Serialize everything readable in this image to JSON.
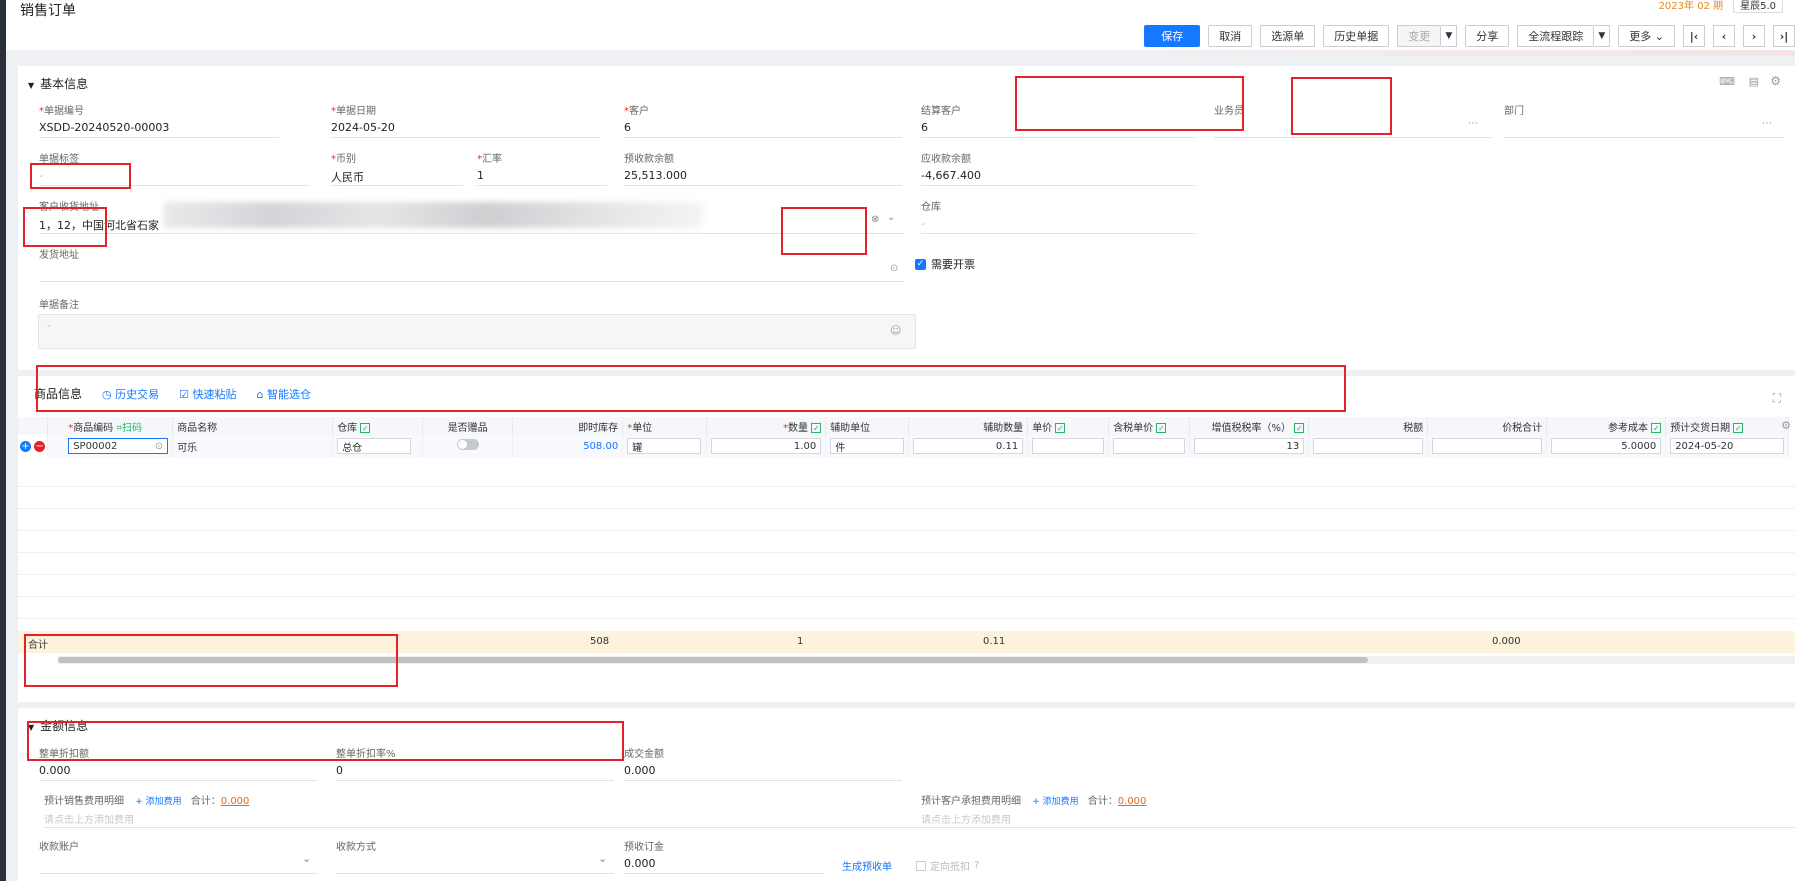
{
  "page": {
    "title": "销售订单"
  },
  "top_right": {
    "date": "2023年 02 期",
    "version": "星辰5.0"
  },
  "toolbar": {
    "save": "保存",
    "cancel": "取消",
    "select_source": "选源单",
    "history": "历史单据",
    "change": "变更",
    "share": "分享",
    "track": "全流程跟踪",
    "more": "更多"
  },
  "basic": {
    "title": "基本信息",
    "doc_no": {
      "label": "单据编号",
      "value": "XSDD-20240520-00003"
    },
    "doc_date": {
      "label": "单据日期",
      "value": "2024-05-20"
    },
    "customer": {
      "label": "客户",
      "value": "6"
    },
    "settle_customer": {
      "label": "结算客户",
      "value": "6"
    },
    "salesman": {
      "label": "业务员",
      "value": ""
    },
    "department": {
      "label": "部门",
      "value": ""
    },
    "doc_tag": {
      "label": "单据标签",
      "value": "-"
    },
    "currency": {
      "label": "币别",
      "value": "人民币"
    },
    "rate": {
      "label": "汇率",
      "value": "1"
    },
    "prepaid_balance": {
      "label": "预收款余额",
      "value": "25,513.000"
    },
    "receivable_balance": {
      "label": "应收款余额",
      "value": "-4,667.400"
    },
    "receive_address": {
      "label": "客户收货地址",
      "value": "1，12，中国河北省石家"
    },
    "warehouse": {
      "label": "仓库",
      "value": "-"
    },
    "ship_address": {
      "label": "发货地址",
      "value": ""
    },
    "invoice": {
      "label": "需要开票",
      "checked": true
    },
    "remark": {
      "label": "单据备注",
      "value": "-"
    }
  },
  "goods": {
    "tabs": {
      "main": "商品信息",
      "history": "历史交易",
      "paste": "快速粘贴",
      "smart": "智能选仓"
    },
    "columns": {
      "code": "商品编码",
      "scan": "扫码",
      "name": "商品名称",
      "warehouse": "仓库",
      "gift": "是否赠品",
      "stock": "即时库存",
      "unit": "单位",
      "qty": "数量",
      "aux_unit": "辅助单位",
      "aux_qty": "辅助数量",
      "price": "单价",
      "tax_price": "含税单价",
      "tax_rate": "增值税税率（%）",
      "tax": "税额",
      "total": "价税合计",
      "ref_cost": "参考成本",
      "delivery": "预计交货日期"
    },
    "row": {
      "code": "SP00002",
      "name": "可乐",
      "warehouse": "总仓",
      "stock": "508.00",
      "unit": "罐",
      "qty": "1.00",
      "aux_unit": "件",
      "aux_qty": "0.11",
      "tax_rate": "13",
      "ref_cost": "5.0000",
      "delivery": "2024-05-20"
    },
    "sum": {
      "label": "合计",
      "stock": "508",
      "qty": "1",
      "aux_qty": "0.11",
      "total": "0.000"
    }
  },
  "amount": {
    "title": "金额信息",
    "discount": {
      "label": "整单折扣额",
      "value": "0.000"
    },
    "discount_rate": {
      "label": "整单折扣率%",
      "value": "0"
    },
    "deal_amount": {
      "label": "成交金额",
      "value": "0.000"
    },
    "sales_fee": {
      "label": "预计销售费用明细",
      "add": "+ 添加费用",
      "sum_label": "合计：",
      "sum": "0.000",
      "hint": "请点击上方添加费用"
    },
    "customer_fee": {
      "label": "预计客户承担费用明细",
      "add": "+ 添加费用",
      "sum_label": "合计：",
      "sum": "0.000",
      "hint": "请点击上方添加费用"
    },
    "account": {
      "label": "收款账户",
      "value": ""
    },
    "method": {
      "label": "收款方式",
      "value": ""
    },
    "deposit": {
      "label": "预收订金",
      "value": "0.000"
    },
    "gen_receipt": "生成预收单",
    "offset": "定向抵扣"
  }
}
